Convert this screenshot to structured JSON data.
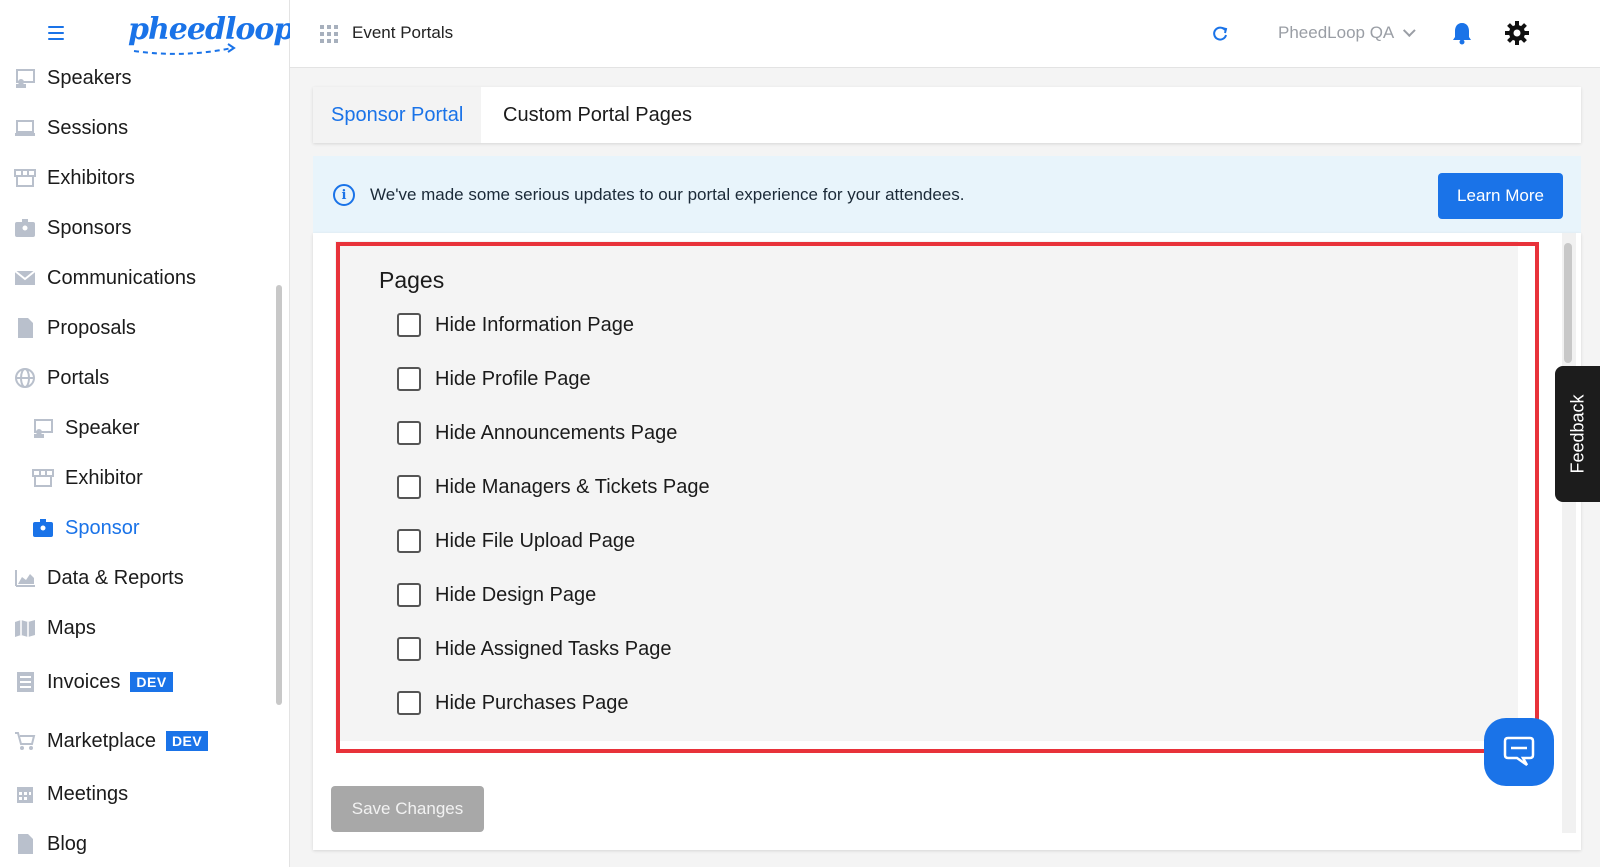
{
  "app": {
    "logo_text": "pheedloop"
  },
  "sidebar": {
    "items": [
      {
        "label": "Speakers",
        "icon": "speaker-icon"
      },
      {
        "label": "Sessions",
        "icon": "laptop-icon"
      },
      {
        "label": "Exhibitors",
        "icon": "store-icon"
      },
      {
        "label": "Sponsors",
        "icon": "badge-icon"
      },
      {
        "label": "Communications",
        "icon": "mail-icon"
      },
      {
        "label": "Proposals",
        "icon": "file-icon"
      },
      {
        "label": "Portals",
        "icon": "globe-icon"
      },
      {
        "label": "Speaker",
        "icon": "speaker-icon",
        "sub": true
      },
      {
        "label": "Exhibitor",
        "icon": "store-icon",
        "sub": true
      },
      {
        "label": "Sponsor",
        "icon": "badge-icon",
        "sub": true,
        "active": true
      },
      {
        "label": "Data & Reports",
        "icon": "chart-icon"
      },
      {
        "label": "Maps",
        "icon": "map-icon"
      },
      {
        "label": "Invoices",
        "icon": "invoice-icon",
        "badge": "DEV"
      },
      {
        "label": "Marketplace",
        "icon": "cart-icon",
        "badge": "DEV"
      },
      {
        "label": "Meetings",
        "icon": "calendar-icon"
      },
      {
        "label": "Blog",
        "icon": "file-icon"
      }
    ]
  },
  "topbar": {
    "title": "Event Portals",
    "account": "PheedLoop QA"
  },
  "tabs": [
    {
      "label": "Sponsor Portal",
      "active": true
    },
    {
      "label": "Custom Portal Pages",
      "active": false
    }
  ],
  "banner": {
    "text": "We've made some serious updates to our portal experience for your attendees.",
    "button": "Learn More"
  },
  "pages": {
    "title": "Pages",
    "options": [
      {
        "label": "Hide Information Page",
        "checked": false
      },
      {
        "label": "Hide Profile Page",
        "checked": false
      },
      {
        "label": "Hide Announcements Page",
        "checked": false
      },
      {
        "label": "Hide Managers & Tickets Page",
        "checked": false
      },
      {
        "label": "Hide File Upload Page",
        "checked": false
      },
      {
        "label": "Hide Design Page",
        "checked": false
      },
      {
        "label": "Hide Assigned Tasks Page",
        "checked": false
      },
      {
        "label": "Hide Purchases Page",
        "checked": false
      }
    ]
  },
  "save_button": "Save Changes",
  "feedback": "Feedback",
  "colors": {
    "accent": "#1a73e8",
    "highlight": "#e8323a",
    "banner_bg": "#e8f4fb"
  }
}
